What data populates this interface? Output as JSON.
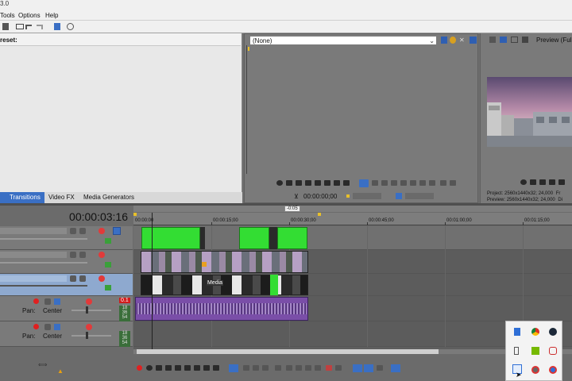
{
  "app": {
    "title_fragment": "3.0"
  },
  "menu": [
    {
      "label": "Tools"
    },
    {
      "label": "Options"
    },
    {
      "label": "Help"
    }
  ],
  "left_panel": {
    "header": "reset:",
    "tabs": [
      "Transitions",
      "Video FX",
      "Media Generators"
    ]
  },
  "trimmer": {
    "dropdown_value": "(None)",
    "timecode": "00:00:00;00"
  },
  "preview": {
    "label": "Preview (Full)",
    "project_label": "Project:",
    "project_value": "2560x1440x32; 24,000",
    "preview_label": "Preview:",
    "preview_value": "2560x1440x32; 24,000",
    "right_prefix_1": "Fr",
    "right_prefix_2": "Di"
  },
  "timeline": {
    "main_timecode": "00:00:03:16",
    "marker": "-0:05",
    "ruler": [
      "00:00:00",
      "00:00:15;00",
      "00:00:30;00",
      "00:00:45;00",
      "00:01:00;00",
      "00:01:15;00"
    ],
    "pan_label": "Pan:",
    "pan_value": "Center",
    "meter_values_a": [
      "18",
      "36",
      "54"
    ],
    "meter_values_b": [
      "18",
      "36",
      "54"
    ],
    "audio_level": "0.1",
    "media_label": "Media"
  },
  "status": {
    "rate": "Rate: 0,00"
  },
  "colors": {
    "green_clip": "#33dd33",
    "audio_clip": "#7a4ea8",
    "selected_track": "#8ea9cf",
    "record": "#e02020"
  }
}
